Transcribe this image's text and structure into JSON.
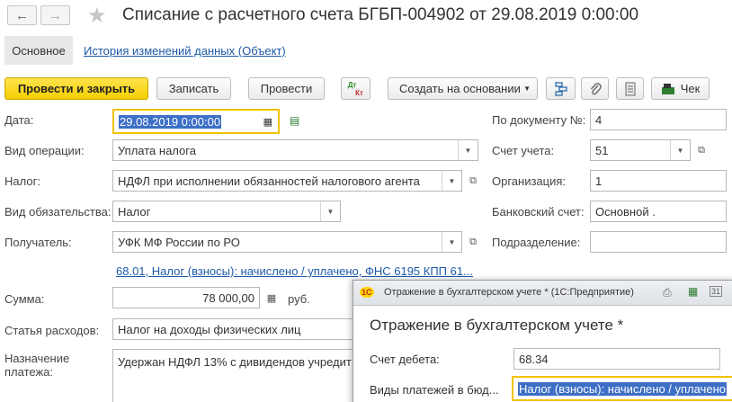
{
  "header": {
    "title": "Списание с расчетного счета БГБП-004902 от 29.08.2019 0:00:00",
    "back_icon": "←",
    "forward_icon": "→",
    "star_icon": "★"
  },
  "tabs": {
    "main": "Основное",
    "history": "История изменений данных (Объект)"
  },
  "toolbar": {
    "post_close": "Провести и закрыть",
    "save": "Записать",
    "post": "Провести",
    "dt_top": "Дт",
    "dt_bottom": "Кт",
    "create_based": "Создать на основании",
    "check": "Чек"
  },
  "form": {
    "date_label": "Дата:",
    "date_value": "29.08.2019  0:00:00",
    "op_label": "Вид операции:",
    "op_value": "Уплата налога",
    "tax_label": "Налог:",
    "tax_value": "НДФЛ при исполнении обязанностей налогового агента",
    "liab_label": "Вид обязательства:",
    "liab_value": "Налог",
    "recipient_label": "Получатель:",
    "recipient_value": "УФК МФ России по РО",
    "account_link": "68.01, Налог (взносы): начислено / уплачено, ФНС 6195 КПП 61...",
    "sum_label": "Сумма:",
    "sum_value": "78 000,00",
    "currency": "руб.",
    "expense_label": "Статья расходов:",
    "expense_value": "Налог на доходы физических лиц",
    "purpose_label_1": "Назначение",
    "purpose_label_2": "платежа:",
    "purpose_value": "Удержан НДФЛ 13% с дивидендов учредит",
    "docnum_label": "По документу №:",
    "docnum_value": "4",
    "acc_label": "Счет учета:",
    "acc_value": "51",
    "org_label": "Организация:",
    "org_value": "1",
    "bank_label": "Банковский счет:",
    "bank_value": "Основной  .",
    "dept_label": "Подразделение:",
    "dept_value": ""
  },
  "popup": {
    "window_title": "Отражение в бухгалтерском учете *  (1С:Предприятие)",
    "app_icon": "1С",
    "heading": "Отражение в бухгалтерском учете *",
    "debit_label": "Счет дебета:",
    "debit_value": "68.34",
    "payment_types_label": "Виды платежей в бюд...",
    "payment_types_value": "Налог (взносы): начислено / уплачено",
    "calendar_day": "31"
  }
}
